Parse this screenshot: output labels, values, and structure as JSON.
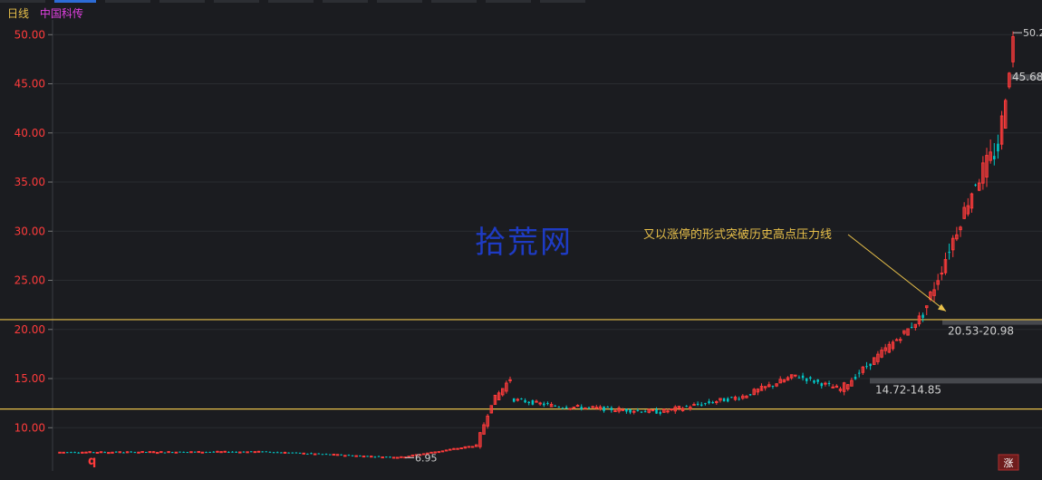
{
  "header": {
    "period": "日线",
    "stock_name": "中国科传",
    "period_color": "#e8c04a",
    "name_color": "#e040e0"
  },
  "watermark": "拾荒网",
  "bottom_left_mark": "q",
  "bottom_right_badge": "涨",
  "chart_data": {
    "type": "candlestick",
    "y_ticks": [
      "10.00",
      "15.00",
      "20.00",
      "25.00",
      "30.00",
      "35.00",
      "40.00",
      "45.00",
      "50.00"
    ],
    "ylim": [
      5.6,
      51.5
    ],
    "colors": {
      "up": "#ff3b3b",
      "down": "#00c8c8",
      "axis_label": "#ff3b3b",
      "support": "#e8c04a",
      "text": "#cfcfcf"
    },
    "support_lines": [
      {
        "value": 21.0
      },
      {
        "value": 11.9
      }
    ],
    "zones": [
      {
        "label": "20.53-20.98",
        "value": 20.75
      },
      {
        "label": "14.72-14.85",
        "value": 14.78
      },
      {
        "label": "45.68",
        "value": 45.68
      }
    ],
    "low_label": {
      "label": "6.95",
      "value": 6.95
    },
    "high_label": {
      "label": "50.2",
      "value": 50.2
    },
    "annotation": {
      "text": "又以涨停的形式突破历史高点压力线",
      "color": "#e8c04a",
      "target_value": 21.3
    },
    "segments": [
      {
        "n": 56,
        "start": 7.5,
        "end": 7.55,
        "vol": 0.12,
        "name": "base-flat-1"
      },
      {
        "n": 30,
        "start": 7.55,
        "end": 7.05,
        "vol": 0.12,
        "name": "base-dip"
      },
      {
        "n": 6,
        "start": 7.05,
        "end": 7.0,
        "vol": 0.1,
        "name": "base-low"
      },
      {
        "n": 20,
        "start": 7.0,
        "end": 8.2,
        "vol": 0.12,
        "name": "base-rise"
      },
      {
        "n": 4,
        "start": 8.2,
        "end": 12.5,
        "vol": 0.5,
        "name": "breakout-1"
      },
      {
        "n": 5,
        "start": 12.5,
        "end": 15.0,
        "vol": 0.6,
        "name": "spike"
      },
      {
        "n": 12,
        "start": 12.9,
        "end": 12.2,
        "vol": 0.4,
        "name": "consolidate-1"
      },
      {
        "n": 28,
        "start": 12.2,
        "end": 11.6,
        "vol": 0.45,
        "name": "consolidate-2"
      },
      {
        "n": 22,
        "start": 11.6,
        "end": 13.2,
        "vol": 0.5,
        "name": "consolidate-3"
      },
      {
        "n": 14,
        "start": 13.2,
        "end": 15.3,
        "vol": 0.55,
        "name": "rise-2"
      },
      {
        "n": 12,
        "start": 15.3,
        "end": 13.9,
        "vol": 0.5,
        "name": "pullback"
      },
      {
        "n": 18,
        "start": 13.9,
        "end": 20.0,
        "vol": 0.7,
        "name": "rise-3"
      },
      {
        "n": 4,
        "start": 20.0,
        "end": 21.5,
        "vol": 0.8,
        "name": "break-high"
      },
      {
        "n": 14,
        "start": 21.5,
        "end": 35.0,
        "vol": 1.5,
        "name": "surge"
      },
      {
        "n": 6,
        "start": 35.0,
        "end": 38.5,
        "vol": 2.2,
        "name": "top-chop"
      },
      {
        "n": 4,
        "start": 38.5,
        "end": 49.5,
        "vol": 1.8,
        "name": "final-surge"
      }
    ],
    "rng_seed": 7
  }
}
